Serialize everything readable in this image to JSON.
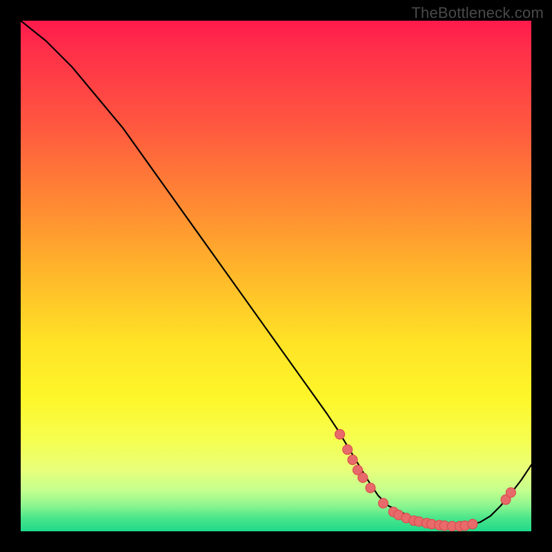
{
  "watermark": "TheBottleneck.com",
  "colors": {
    "dot_fill": "#e86a6a",
    "dot_stroke": "#d84c4c",
    "curve": "#000000"
  },
  "chart_data": {
    "type": "line",
    "title": "",
    "xlabel": "",
    "ylabel": "",
    "xlim": [
      0,
      100
    ],
    "ylim": [
      0,
      100
    ],
    "grid": false,
    "legend": false,
    "series": [
      {
        "name": "curve",
        "x": [
          0,
          5,
          10,
          15,
          20,
          25,
          30,
          35,
          40,
          45,
          50,
          55,
          60,
          62,
          65,
          68,
          70,
          72,
          74,
          76,
          78,
          80,
          82,
          84,
          86,
          88,
          90,
          92,
          94,
          96,
          98,
          100
        ],
        "y": [
          100,
          96,
          91,
          85,
          79,
          72,
          65,
          58,
          51,
          44,
          37,
          30,
          23,
          20,
          15,
          10,
          7,
          5,
          4,
          3,
          2.2,
          1.6,
          1.2,
          1.0,
          1.0,
          1.2,
          1.8,
          3.0,
          5.0,
          7.4,
          10.0,
          13.0
        ]
      }
    ],
    "points": [
      {
        "x": 62.5,
        "y": 19.0
      },
      {
        "x": 64.0,
        "y": 16.0
      },
      {
        "x": 65.0,
        "y": 14.0
      },
      {
        "x": 66.0,
        "y": 12.0
      },
      {
        "x": 67.0,
        "y": 10.5
      },
      {
        "x": 68.5,
        "y": 8.5
      },
      {
        "x": 71.0,
        "y": 5.5
      },
      {
        "x": 73.0,
        "y": 3.8
      },
      {
        "x": 74.0,
        "y": 3.2
      },
      {
        "x": 75.5,
        "y": 2.6
      },
      {
        "x": 77.0,
        "y": 2.1
      },
      {
        "x": 78.0,
        "y": 1.9
      },
      {
        "x": 79.5,
        "y": 1.6
      },
      {
        "x": 80.5,
        "y": 1.4
      },
      {
        "x": 82.0,
        "y": 1.2
      },
      {
        "x": 83.0,
        "y": 1.1
      },
      {
        "x": 84.5,
        "y": 1.0
      },
      {
        "x": 86.0,
        "y": 1.0
      },
      {
        "x": 87.0,
        "y": 1.1
      },
      {
        "x": 88.5,
        "y": 1.4
      },
      {
        "x": 95.0,
        "y": 6.2
      },
      {
        "x": 96.0,
        "y": 7.6
      }
    ],
    "point_radius": 7
  }
}
